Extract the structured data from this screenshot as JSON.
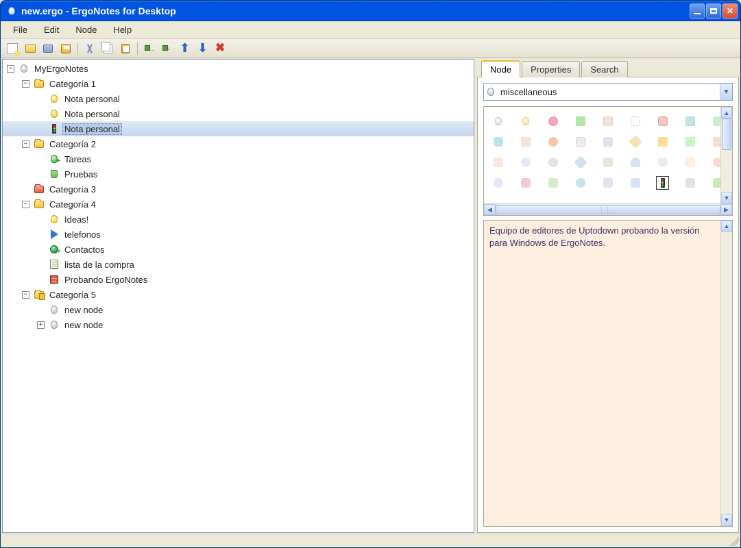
{
  "window": {
    "title": "new.ergo - ErgoNotes for Desktop"
  },
  "menu": {
    "file": "File",
    "edit": "Edit",
    "node": "Node",
    "help": "Help"
  },
  "toolbar_tips": {
    "new": "New",
    "open": "Open",
    "open2": "Open DB",
    "save": "Save",
    "cut": "Cut",
    "copy": "Copy",
    "paste": "Paste",
    "child": "Insert child",
    "sibling": "Insert sibling",
    "up": "Move up",
    "down": "Move down",
    "delete": "Delete"
  },
  "tree": {
    "root": "MyErgoNotes",
    "c1": {
      "label": "Categoría 1",
      "n1": "Nota personal",
      "n2": "Nota personal",
      "n3": "Nota personal"
    },
    "c2": {
      "label": "Categoría 2",
      "n1": "Tareas",
      "n2": "Pruebas"
    },
    "c3": {
      "label": "Categoría 3"
    },
    "c4": {
      "label": "Categoría 4",
      "n1": "Ideas!",
      "n2": "telefonos",
      "n3": "Contactos",
      "n4": "lista de la compra",
      "n5": "Probando ErgoNotes"
    },
    "c5": {
      "label": "Categoría 5",
      "n1": "new node",
      "n2": "new node"
    }
  },
  "tabs": {
    "node": "Node",
    "properties": "Properties",
    "search": "Search"
  },
  "combo": {
    "selected": "miscellaneous"
  },
  "note": {
    "text": "Equipo de editores de Uptodown probando la versión para Windows de ErgoNotes."
  }
}
